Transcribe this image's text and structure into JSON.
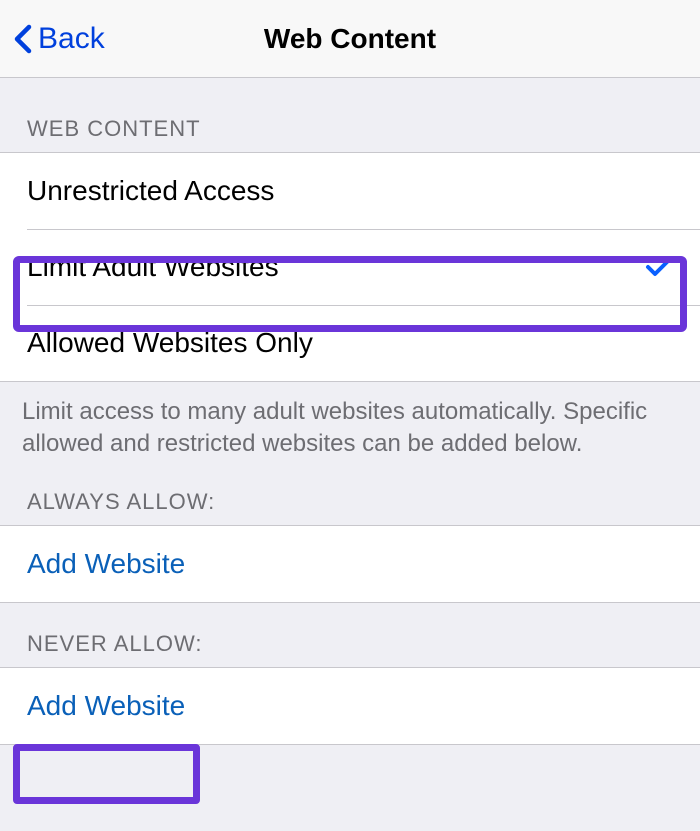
{
  "nav": {
    "back_label": "Back",
    "title": "Web Content"
  },
  "sections": {
    "web_content": {
      "header": "Web Content",
      "options": {
        "unrestricted": "Unrestricted Access",
        "limit_adult": "Limit Adult Websites",
        "allowed_only": "Allowed Websites Only"
      },
      "footer": "Limit access to many adult websites automatically. Specific allowed and restricted websites can be added below."
    },
    "always_allow": {
      "header": "Always Allow:",
      "add_label": "Add Website"
    },
    "never_allow": {
      "header": "Never Allow:",
      "add_label": "Add Website"
    }
  }
}
